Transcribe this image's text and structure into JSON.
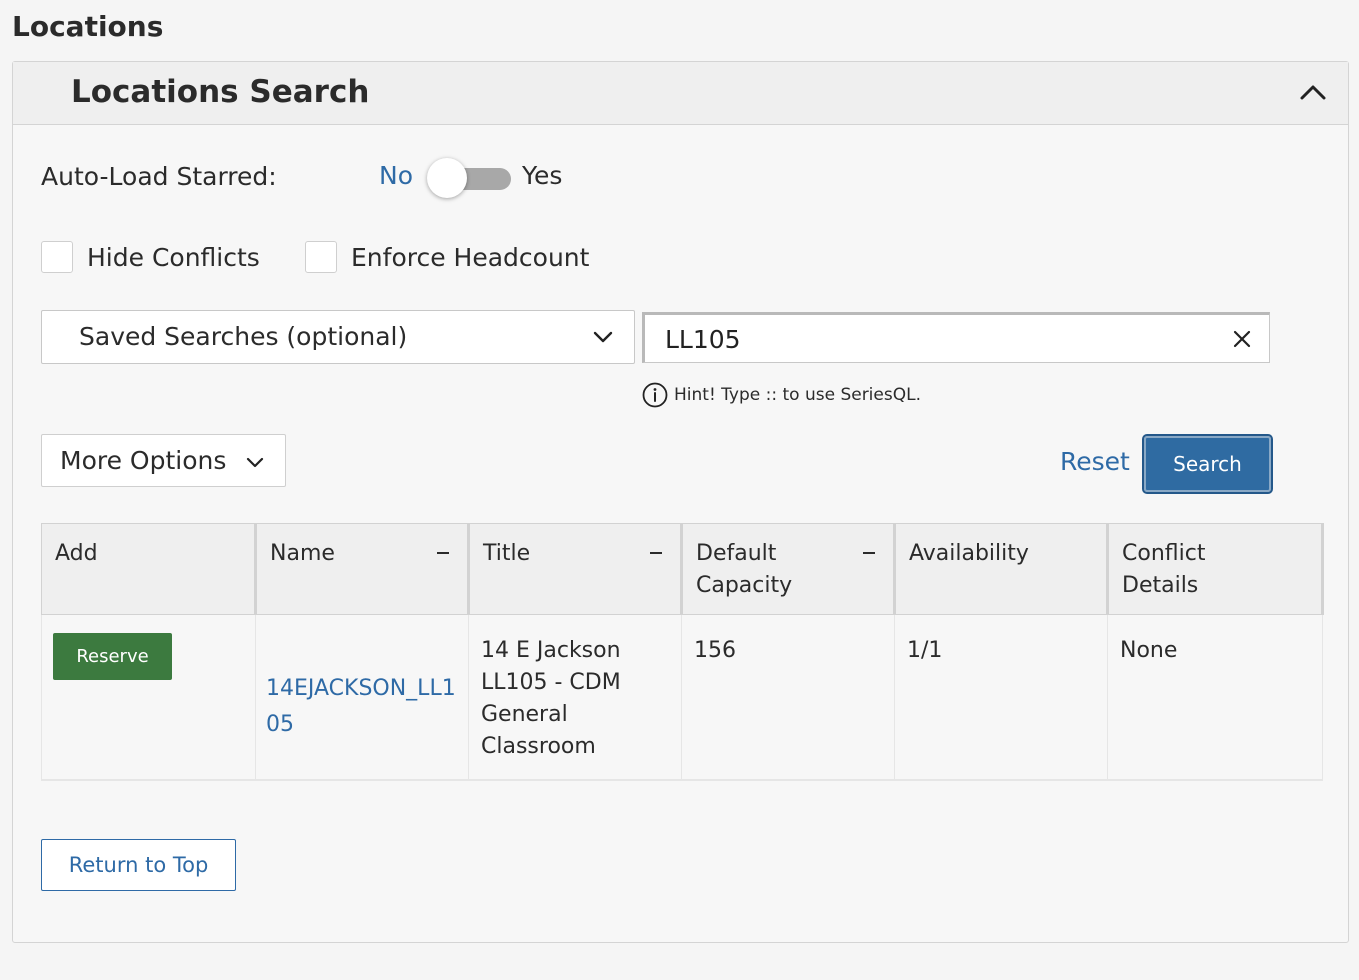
{
  "page": {
    "title": "Locations"
  },
  "panel": {
    "title": "Locations Search"
  },
  "auto_load": {
    "label": "Auto-Load Starred:",
    "off_label": "No",
    "on_label": "Yes",
    "value": false
  },
  "filters": {
    "hide_conflicts": {
      "label": "Hide Conflicts",
      "checked": false
    },
    "enforce_headcount": {
      "label": "Enforce Headcount",
      "checked": false
    }
  },
  "saved_searches": {
    "placeholder": "Saved Searches (optional)"
  },
  "search": {
    "value": "LL105",
    "hint": "Hint! Type :: to use SeriesQL."
  },
  "more_options": {
    "label": "More Options"
  },
  "actions": {
    "reset_label": "Reset",
    "search_label": "Search"
  },
  "table": {
    "columns": [
      {
        "label": "Add",
        "sortable": false
      },
      {
        "label": "Name",
        "sortable": true
      },
      {
        "label": "Title",
        "sortable": true
      },
      {
        "label": "Default Capacity",
        "sortable": true
      },
      {
        "label": "Availability",
        "sortable": false
      },
      {
        "label": "Conflict Details",
        "sortable": false
      }
    ],
    "rows": [
      {
        "add_label": "Reserve",
        "name": "14EJACKSON_LL105",
        "title": "14 E Jackson LL105 - CDM General Classroom",
        "capacity": "156",
        "availability": "1/1",
        "conflict_details": "None"
      }
    ]
  },
  "footer": {
    "return_top_label": "Return to Top"
  },
  "colors": {
    "link_blue": "#2e6aa6",
    "primary_button": "#2f6ba2",
    "reserve_green": "#3c7a3f",
    "toggle_track": "#a8a8a8"
  },
  "icons": {
    "collapse": "chevron-up-icon",
    "select": "chevron-down-icon",
    "clear": "close-icon",
    "hint": "info-icon",
    "more_options": "chevron-down-icon",
    "sort": "sort-dash-icon"
  }
}
